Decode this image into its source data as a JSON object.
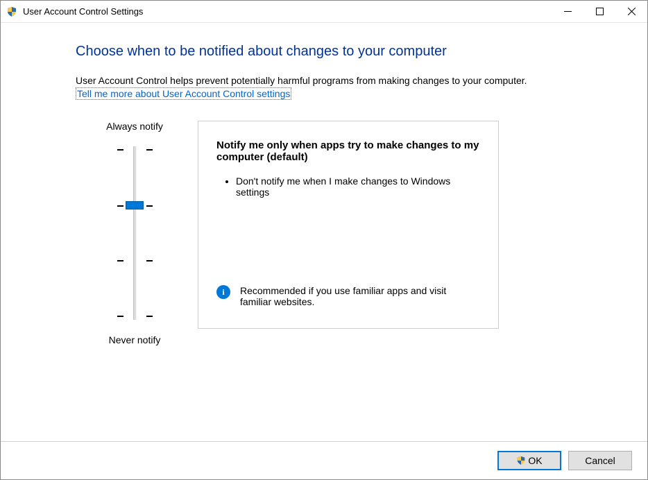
{
  "window": {
    "title": "User Account Control Settings"
  },
  "main": {
    "heading": "Choose when to be notified about changes to your computer",
    "description": "User Account Control helps prevent potentially harmful programs from making changes to your computer.",
    "help_link": "Tell me more about User Account Control settings"
  },
  "slider": {
    "top_label": "Always notify",
    "bottom_label": "Never notify",
    "level_count": 4,
    "current_level": 1
  },
  "panel": {
    "title": "Notify me only when apps try to make changes to my computer (default)",
    "bullets": [
      "Don't notify me when I make changes to Windows settings"
    ],
    "recommend": "Recommended if you use familiar apps and visit familiar websites."
  },
  "footer": {
    "ok_label": "OK",
    "cancel_label": "Cancel"
  },
  "icons": {
    "shield": "shield-icon",
    "info": "info-icon",
    "minimize": "minimize-icon",
    "maximize": "maximize-icon",
    "close": "close-icon"
  }
}
